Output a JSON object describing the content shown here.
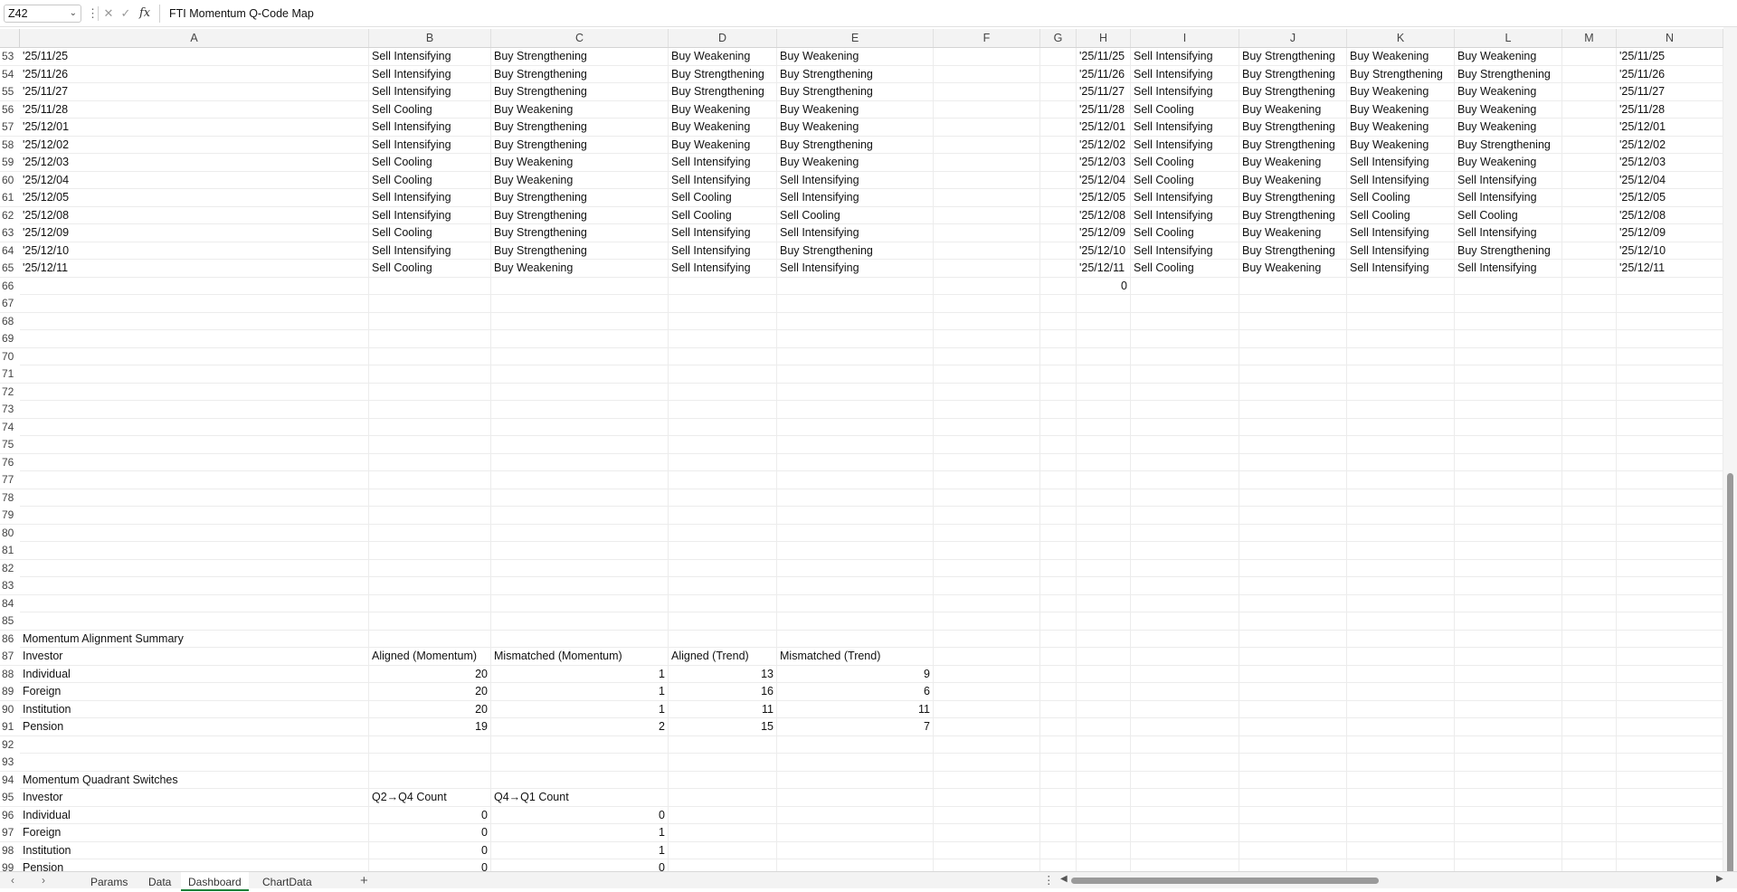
{
  "formula_bar": {
    "name_box": "Z42",
    "fx_label": "fx",
    "formula": "FTI Momentum Q-Code Map"
  },
  "columns": [
    "A",
    "B",
    "C",
    "D",
    "E",
    "F",
    "G",
    "H",
    "I",
    "J",
    "K",
    "L",
    "M",
    "N"
  ],
  "rows": [
    {
      "n": "53",
      "A": "'25/11/25",
      "B": "Sell Intensifying",
      "C": "Buy Strengthening",
      "D": "Buy Weakening",
      "E": "Buy Weakening",
      "H": "'25/11/25",
      "I": "Sell Intensifying",
      "J": "Buy Strengthening",
      "K": "Buy Weakening",
      "L": "Buy Weakening",
      "N": "'25/11/25"
    },
    {
      "n": "54",
      "A": "'25/11/26",
      "B": "Sell Intensifying",
      "C": "Buy Strengthening",
      "D": "Buy Strengthening",
      "E": "Buy Strengthening",
      "H": "'25/11/26",
      "I": "Sell Intensifying",
      "J": "Buy Strengthening",
      "K": "Buy Strengthening",
      "L": "Buy Strengthening",
      "N": "'25/11/26"
    },
    {
      "n": "55",
      "A": "'25/11/27",
      "B": "Sell Intensifying",
      "C": "Buy Strengthening",
      "D": "Buy Strengthening",
      "E": "Buy Strengthening",
      "H": "'25/11/27",
      "I": "Sell Intensifying",
      "J": "Buy Strengthening",
      "K": "Buy Weakening",
      "L": "Buy Weakening",
      "N": "'25/11/27"
    },
    {
      "n": "56",
      "A": "'25/11/28",
      "B": "Sell Cooling",
      "C": "Buy Weakening",
      "D": "Buy Weakening",
      "E": "Buy Weakening",
      "H": "'25/11/28",
      "I": "Sell Cooling",
      "J": "Buy Weakening",
      "K": "Buy Weakening",
      "L": "Buy Weakening",
      "N": "'25/11/28"
    },
    {
      "n": "57",
      "A": "'25/12/01",
      "B": "Sell Intensifying",
      "C": "Buy Strengthening",
      "D": "Buy Weakening",
      "E": "Buy Weakening",
      "H": "'25/12/01",
      "I": "Sell Intensifying",
      "J": "Buy Strengthening",
      "K": "Buy Weakening",
      "L": "Buy Weakening",
      "N": "'25/12/01"
    },
    {
      "n": "58",
      "A": "'25/12/02",
      "B": "Sell Intensifying",
      "C": "Buy Strengthening",
      "D": "Buy Weakening",
      "E": "Buy Strengthening",
      "H": "'25/12/02",
      "I": "Sell Intensifying",
      "J": "Buy Strengthening",
      "K": "Buy Weakening",
      "L": "Buy Strengthening",
      "N": "'25/12/02"
    },
    {
      "n": "59",
      "A": "'25/12/03",
      "B": "Sell Cooling",
      "C": "Buy Weakening",
      "D": "Sell Intensifying",
      "E": "Buy Weakening",
      "H": "'25/12/03",
      "I": "Sell Cooling",
      "J": "Buy Weakening",
      "K": "Sell Intensifying",
      "L": "Buy Weakening",
      "N": "'25/12/03"
    },
    {
      "n": "60",
      "A": "'25/12/04",
      "B": "Sell Cooling",
      "C": "Buy Weakening",
      "D": "Sell Intensifying",
      "E": "Sell Intensifying",
      "H": "'25/12/04",
      "I": "Sell Cooling",
      "J": "Buy Weakening",
      "K": "Sell Intensifying",
      "L": "Sell Intensifying",
      "N": "'25/12/04"
    },
    {
      "n": "61",
      "A": "'25/12/05",
      "B": "Sell Intensifying",
      "C": "Buy Strengthening",
      "D": "Sell Cooling",
      "E": "Sell Intensifying",
      "H": "'25/12/05",
      "I": "Sell Intensifying",
      "J": "Buy Strengthening",
      "K": "Sell Cooling",
      "L": "Sell Intensifying",
      "N": "'25/12/05"
    },
    {
      "n": "62",
      "A": "'25/12/08",
      "B": "Sell Intensifying",
      "C": "Buy Strengthening",
      "D": "Sell Cooling",
      "E": "Sell Cooling",
      "H": "'25/12/08",
      "I": "Sell Intensifying",
      "J": "Buy Strengthening",
      "K": "Sell Cooling",
      "L": "Sell Cooling",
      "N": "'25/12/08"
    },
    {
      "n": "63",
      "A": "'25/12/09",
      "B": "Sell Cooling",
      "C": "Buy Strengthening",
      "D": "Sell Intensifying",
      "E": "Sell Intensifying",
      "H": "'25/12/09",
      "I": "Sell Cooling",
      "J": "Buy Weakening",
      "K": "Sell Intensifying",
      "L": "Sell Intensifying",
      "N": "'25/12/09"
    },
    {
      "n": "64",
      "A": "'25/12/10",
      "B": "Sell Intensifying",
      "C": "Buy Strengthening",
      "D": "Sell Intensifying",
      "E": "Buy Strengthening",
      "H": "'25/12/10",
      "I": "Sell Intensifying",
      "J": "Buy Strengthening",
      "K": "Sell Intensifying",
      "L": "Buy Strengthening",
      "N": "'25/12/10"
    },
    {
      "n": "65",
      "A": "'25/12/11",
      "B": "Sell Cooling",
      "C": "Buy Weakening",
      "D": "Sell Intensifying",
      "E": "Sell Intensifying",
      "H": "'25/12/11",
      "I": "Sell Cooling",
      "J": "Buy Weakening",
      "K": "Sell Intensifying",
      "L": "Sell Intensifying",
      "N": "'25/12/11"
    },
    {
      "n": "66",
      "H": "0",
      "num": [
        "H"
      ]
    },
    {
      "n": "67"
    },
    {
      "n": "68"
    },
    {
      "n": "69"
    },
    {
      "n": "70"
    },
    {
      "n": "71"
    },
    {
      "n": "72"
    },
    {
      "n": "73"
    },
    {
      "n": "74"
    },
    {
      "n": "75"
    },
    {
      "n": "76"
    },
    {
      "n": "77"
    },
    {
      "n": "78"
    },
    {
      "n": "79"
    },
    {
      "n": "80"
    },
    {
      "n": "81"
    },
    {
      "n": "82"
    },
    {
      "n": "83"
    },
    {
      "n": "84"
    },
    {
      "n": "85"
    },
    {
      "n": "86",
      "A": "Momentum Alignment Summary"
    },
    {
      "n": "87",
      "A": "Investor",
      "B": "Aligned (Momentum)",
      "C": "Mismatched (Momentum)",
      "D": "Aligned (Trend)",
      "E": "Mismatched (Trend)"
    },
    {
      "n": "88",
      "A": "Individual",
      "B": "20",
      "C": "1",
      "D": "13",
      "E": "9",
      "num": [
        "B",
        "C",
        "D",
        "E"
      ]
    },
    {
      "n": "89",
      "A": "Foreign",
      "B": "20",
      "C": "1",
      "D": "16",
      "E": "6",
      "num": [
        "B",
        "C",
        "D",
        "E"
      ]
    },
    {
      "n": "90",
      "A": "Institution",
      "B": "20",
      "C": "1",
      "D": "11",
      "E": "11",
      "num": [
        "B",
        "C",
        "D",
        "E"
      ]
    },
    {
      "n": "91",
      "A": "Pension",
      "B": "19",
      "C": "2",
      "D": "15",
      "E": "7",
      "num": [
        "B",
        "C",
        "D",
        "E"
      ]
    },
    {
      "n": "92"
    },
    {
      "n": "93"
    },
    {
      "n": "94",
      "A": "Momentum Quadrant Switches"
    },
    {
      "n": "95",
      "A": "Investor",
      "B": "Q2→Q4 Count",
      "C": "Q4→Q1 Count"
    },
    {
      "n": "96",
      "A": "Individual",
      "B": "0",
      "C": "0",
      "num": [
        "B",
        "C"
      ]
    },
    {
      "n": "97",
      "A": "Foreign",
      "B": "0",
      "C": "1",
      "num": [
        "B",
        "C"
      ]
    },
    {
      "n": "98",
      "A": "Institution",
      "B": "0",
      "C": "1",
      "num": [
        "B",
        "C"
      ]
    },
    {
      "n": "99",
      "A": "Pension",
      "B": "0",
      "C": "0",
      "num": [
        "B",
        "C"
      ]
    }
  ],
  "sheet_tabs": [
    {
      "label": "Params",
      "active": false
    },
    {
      "label": "Data",
      "active": false
    },
    {
      "label": "Dashboard",
      "active": true
    },
    {
      "label": "ChartData",
      "active": false
    }
  ],
  "add_sheet_label": "+",
  "icons": {
    "name_box_dropdown": "chevron-down-icon",
    "cancel": "close-icon",
    "enter": "check-icon",
    "function": "fx-icon",
    "prev_sheet": "chevron-left-icon",
    "next_sheet": "chevron-right-icon"
  }
}
